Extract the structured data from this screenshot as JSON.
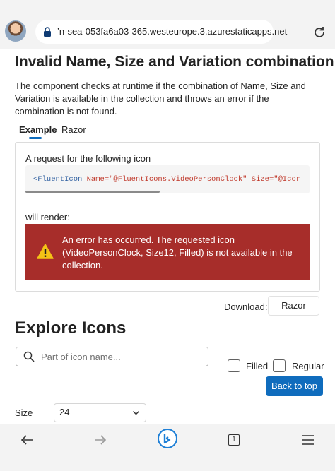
{
  "browser": {
    "url": "’n-sea-053fa6a03-365.westeurope.3.azurestaticapps.net",
    "tab_count": "1"
  },
  "section": {
    "title": "Invalid Name, Size and Variation combination",
    "description": "The component checks at runtime if the combination of Name, Size and Variation is available in the collection and throws an error if the combination is not found.",
    "tabs": [
      {
        "label": "Example",
        "active": true
      },
      {
        "label": "Razor",
        "active": false
      }
    ],
    "request_label": "A request for the following icon",
    "code": {
      "tag": "<FluentIcon",
      "attr_name": " Name=",
      "name_value": "\"@FluentIcons.VideoPersonClock\"",
      "attr_size": " Size=",
      "size_value": "\"@Icor"
    },
    "render_label": "will render:",
    "error_message": "An error has occurred. The requested icon (VideoPersonClock, Size12, Filled) is not available in the collection."
  },
  "download": {
    "label": "Download:",
    "button": "Razor"
  },
  "explore": {
    "title": "Explore Icons",
    "search_placeholder": "Part of icon name...",
    "filled_label": "Filled",
    "regular_label": "Regular",
    "back_to_top": "Back to top",
    "size_label": "Size",
    "size_value": "24"
  },
  "colors": {
    "accent": "#0f6cbd",
    "error_bg": "#a72d2a",
    "warning": "#f3c316"
  }
}
